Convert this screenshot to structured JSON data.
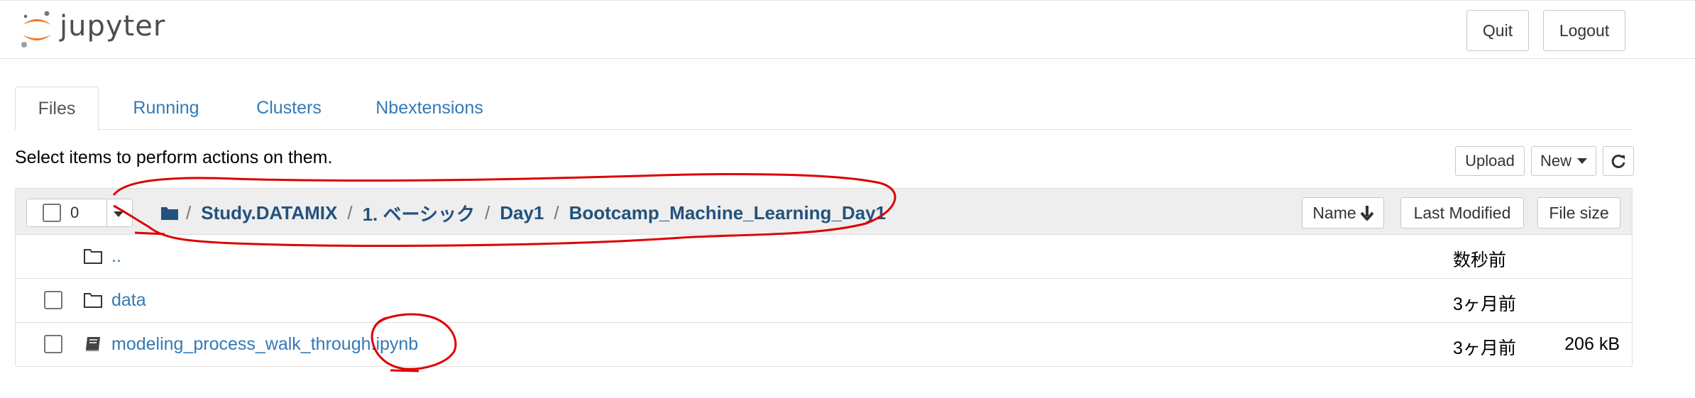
{
  "header": {
    "logo_text": "jupyter",
    "quit_label": "Quit",
    "logout_label": "Logout"
  },
  "tabs": [
    {
      "label": "Files",
      "active": true
    },
    {
      "label": "Running",
      "active": false
    },
    {
      "label": "Clusters",
      "active": false
    },
    {
      "label": "Nbextensions",
      "active": false
    }
  ],
  "toolbar": {
    "hint": "Select items to perform actions on them.",
    "upload_label": "Upload",
    "new_label": "New",
    "refresh_icon": "refresh-icon"
  },
  "list_header": {
    "selected_count": "0",
    "breadcrumb": {
      "separator": "/",
      "items": [
        "Study.DATAMIX",
        "1. ベーシック",
        "Day1",
        "Bootcamp_Machine_Learning_Day1"
      ]
    },
    "sort_name": "Name",
    "sort_modified": "Last Modified",
    "sort_size": "File size"
  },
  "rows": [
    {
      "name": "..",
      "icon": "folder-icon",
      "modified": "数秒前",
      "size": ""
    },
    {
      "name": "data",
      "icon": "folder-icon",
      "modified": "3ヶ月前",
      "size": ""
    },
    {
      "name": "modeling_process_walk_through.ipynb",
      "icon": "notebook-icon",
      "modified": "3ヶ月前",
      "size": "206 kB"
    }
  ],
  "colors": {
    "link": "#337ab7",
    "annotation": "#dd0000",
    "jupyter_orange": "#f37726"
  }
}
